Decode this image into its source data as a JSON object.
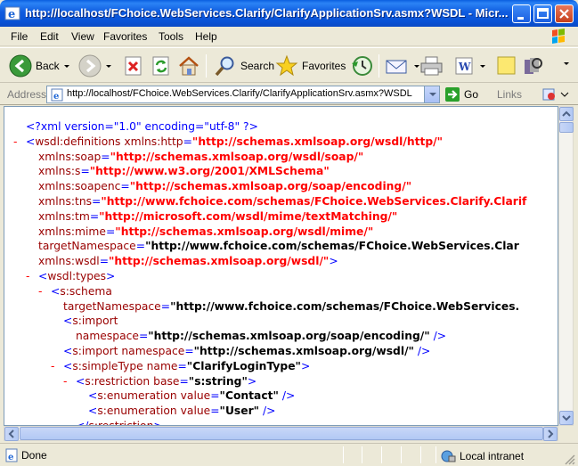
{
  "window": {
    "title": "http://localhost/FChoice.WebServices.Clarify/ClarifyApplicationSrv.asmx?WSDL - Micr..."
  },
  "menu": [
    "File",
    "Edit",
    "View",
    "Favorites",
    "Tools",
    "Help"
  ],
  "toolbar": {
    "back": "Back",
    "search": "Search",
    "favorites": "Favorites"
  },
  "address": {
    "label": "Address",
    "url": "http://localhost/FChoice.WebServices.Clarify/ClarifyApplicationSrv.asmx?WSDL",
    "go": "Go",
    "links": "Links"
  },
  "xml": [
    {
      "m": "",
      "i": 1,
      "parts": [
        [
          "b",
          "<?xml version=\"1.0\" encoding=\"utf-8\" ?>"
        ]
      ]
    },
    {
      "m": "-",
      "i": 1,
      "parts": [
        [
          "b",
          "<"
        ],
        [
          "t",
          "wsdl:definitions "
        ],
        [
          "an",
          "xmlns:http"
        ],
        [
          "b",
          "="
        ],
        [
          "ns",
          "\"http://schemas.xmlsoap.org/wsdl/http/\""
        ]
      ]
    },
    {
      "m": "",
      "i": 2,
      "parts": [
        [
          "an",
          "xmlns:soap"
        ],
        [
          "b",
          "="
        ],
        [
          "ns",
          "\"http://schemas.xmlsoap.org/wsdl/soap/\""
        ]
      ]
    },
    {
      "m": "",
      "i": 2,
      "parts": [
        [
          "an",
          "xmlns:s"
        ],
        [
          "b",
          "="
        ],
        [
          "ns",
          "\"http://www.w3.org/2001/XMLSchema\""
        ]
      ]
    },
    {
      "m": "",
      "i": 2,
      "parts": [
        [
          "an",
          "xmlns:soapenc"
        ],
        [
          "b",
          "="
        ],
        [
          "ns",
          "\"http://schemas.xmlsoap.org/soap/encoding/\""
        ]
      ]
    },
    {
      "m": "",
      "i": 2,
      "parts": [
        [
          "an",
          "xmlns:tns"
        ],
        [
          "b",
          "="
        ],
        [
          "ns",
          "\"http://www.fchoice.com/schemas/FChoice.WebServices.Clarify.Clarif"
        ]
      ]
    },
    {
      "m": "",
      "i": 2,
      "parts": [
        [
          "an",
          "xmlns:tm"
        ],
        [
          "b",
          "="
        ],
        [
          "ns",
          "\"http://microsoft.com/wsdl/mime/textMatching/\""
        ]
      ]
    },
    {
      "m": "",
      "i": 2,
      "parts": [
        [
          "an",
          "xmlns:mime"
        ],
        [
          "b",
          "="
        ],
        [
          "ns",
          "\"http://schemas.xmlsoap.org/wsdl/mime/\""
        ]
      ]
    },
    {
      "m": "",
      "i": 2,
      "parts": [
        [
          "an",
          "targetNamespace"
        ],
        [
          "b",
          "="
        ],
        [
          "v",
          "\"http://www.fchoice.com/schemas/FChoice.WebServices.Clar"
        ]
      ]
    },
    {
      "m": "",
      "i": 2,
      "parts": [
        [
          "an",
          "xmlns:wsdl"
        ],
        [
          "b",
          "="
        ],
        [
          "ns",
          "\"http://schemas.xmlsoap.org/wsdl/\""
        ],
        [
          "b",
          ">"
        ]
      ]
    },
    {
      "m": "-",
      "i": 2,
      "parts": [
        [
          "b",
          "<"
        ],
        [
          "t",
          "wsdl:types"
        ],
        [
          "b",
          ">"
        ]
      ]
    },
    {
      "m": "-",
      "i": 3,
      "parts": [
        [
          "b",
          "<"
        ],
        [
          "t",
          "s:schema"
        ]
      ]
    },
    {
      "m": "",
      "i": 4,
      "parts": [
        [
          "an",
          "targetNamespace"
        ],
        [
          "b",
          "="
        ],
        [
          "v",
          "\"http://www.fchoice.com/schemas/FChoice.WebServices."
        ]
      ]
    },
    {
      "m": "",
      "i": 4,
      "parts": [
        [
          "b",
          "<"
        ],
        [
          "t",
          "s:import"
        ]
      ]
    },
    {
      "m": "",
      "i": 5,
      "parts": [
        [
          "an",
          "namespace"
        ],
        [
          "b",
          "="
        ],
        [
          "v",
          "\"http://schemas.xmlsoap.org/soap/encoding/\""
        ],
        [
          "b",
          " />"
        ]
      ]
    },
    {
      "m": "",
      "i": 4,
      "parts": [
        [
          "b",
          "<"
        ],
        [
          "t",
          "s:import "
        ],
        [
          "an",
          "namespace"
        ],
        [
          "b",
          "="
        ],
        [
          "v",
          "\"http://schemas.xmlsoap.org/wsdl/\""
        ],
        [
          "b",
          " />"
        ]
      ]
    },
    {
      "m": "-",
      "i": 4,
      "parts": [
        [
          "b",
          "<"
        ],
        [
          "t",
          "s:simpleType "
        ],
        [
          "an",
          "name"
        ],
        [
          "b",
          "="
        ],
        [
          "v",
          "\"ClarifyLoginType\""
        ],
        [
          "b",
          ">"
        ]
      ]
    },
    {
      "m": "-",
      "i": 5,
      "parts": [
        [
          "b",
          "<"
        ],
        [
          "t",
          "s:restriction "
        ],
        [
          "an",
          "base"
        ],
        [
          "b",
          "="
        ],
        [
          "v",
          "\"s:string\""
        ],
        [
          "b",
          ">"
        ]
      ]
    },
    {
      "m": "",
      "i": 6,
      "parts": [
        [
          "b",
          "<"
        ],
        [
          "t",
          "s:enumeration "
        ],
        [
          "an",
          "value"
        ],
        [
          "b",
          "="
        ],
        [
          "v",
          "\"Contact\""
        ],
        [
          "b",
          " />"
        ]
      ]
    },
    {
      "m": "",
      "i": 6,
      "parts": [
        [
          "b",
          "<"
        ],
        [
          "t",
          "s:enumeration "
        ],
        [
          "an",
          "value"
        ],
        [
          "b",
          "="
        ],
        [
          "v",
          "\"User\""
        ],
        [
          "b",
          " />"
        ]
      ]
    },
    {
      "m": "",
      "i": 5,
      "parts": [
        [
          "b",
          "</"
        ],
        [
          "t",
          "s:restriction"
        ],
        [
          "b",
          ">"
        ]
      ]
    }
  ],
  "status": {
    "text": "Done",
    "zone": "Local intranet"
  }
}
